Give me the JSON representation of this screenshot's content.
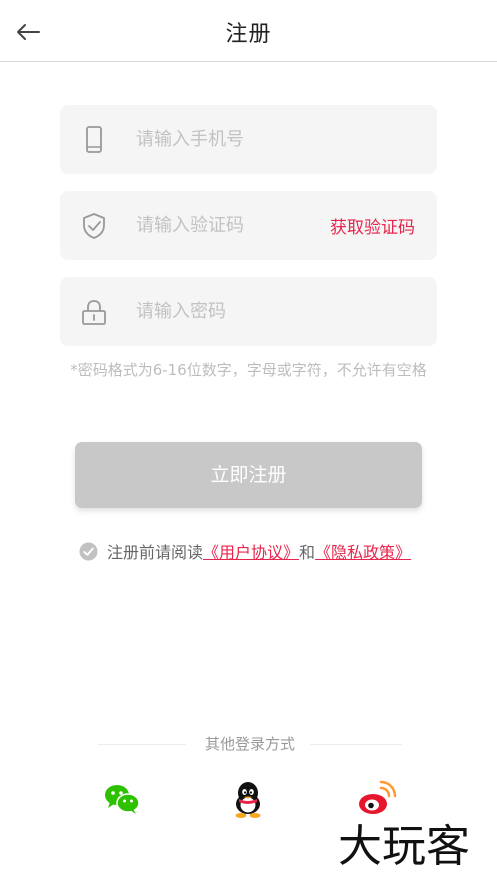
{
  "header": {
    "title": "注册",
    "back_icon": "arrow-left-icon"
  },
  "form": {
    "phone": {
      "placeholder": "请输入手机号",
      "value": "",
      "icon": "phone-icon"
    },
    "code": {
      "placeholder": "请输入验证码",
      "value": "",
      "icon": "shield-icon",
      "get_code_label": "获取验证码"
    },
    "password": {
      "placeholder": "请输入密码",
      "value": "",
      "icon": "lock-icon"
    },
    "hint": "*密码格式为6-16位数字，字母或字符，不允许有空格",
    "submit_label": "立即注册"
  },
  "agreement": {
    "prefix": "注册前请阅读",
    "user_agreement": "《用户协议》",
    "connector": "和",
    "privacy_policy": "《隐私政策》"
  },
  "other_login": {
    "label": "其他登录方式",
    "providers": [
      "wechat-icon",
      "qq-icon",
      "weibo-icon"
    ]
  },
  "watermark": "大玩客",
  "colors": {
    "accent": "#e8254c",
    "button_disabled": "#c8c8c8",
    "field_bg": "#f5f5f5",
    "wechat": "#2dc100"
  }
}
